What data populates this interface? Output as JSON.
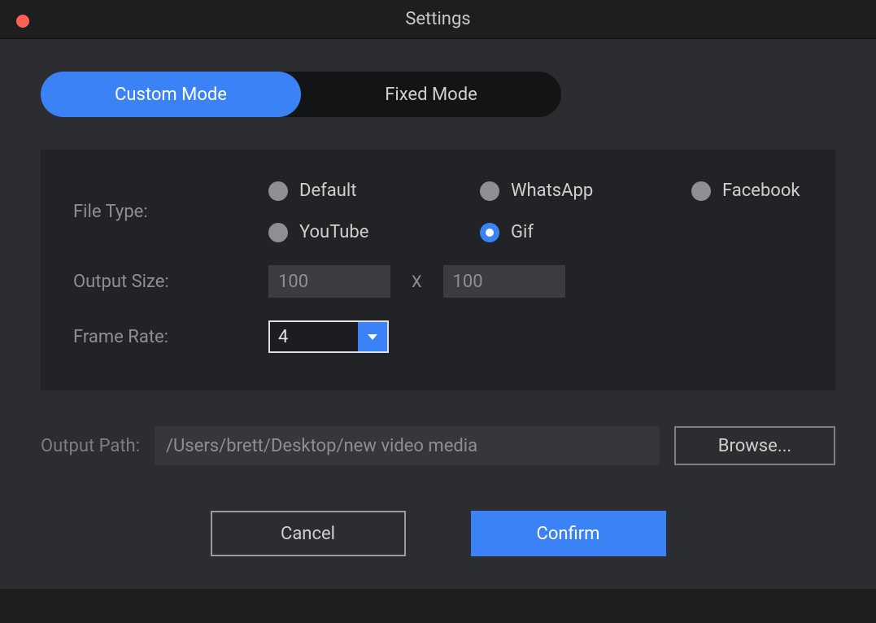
{
  "window": {
    "title": "Settings"
  },
  "tabs": {
    "custom": "Custom Mode",
    "fixed": "Fixed Mode",
    "active": "custom"
  },
  "file_type": {
    "label": "File Type:",
    "options": {
      "default": "Default",
      "whatsapp": "WhatsApp",
      "facebook": "Facebook",
      "youtube": "YouTube",
      "gif": "Gif"
    },
    "selected": "gif"
  },
  "output_size": {
    "label": "Output Size:",
    "width": "100",
    "height": "100",
    "separator": "X"
  },
  "frame_rate": {
    "label": "Frame Rate:",
    "value": "4"
  },
  "output_path": {
    "label": "Output Path:",
    "value": "/Users/brett/Desktop/new video media"
  },
  "buttons": {
    "browse": "Browse...",
    "cancel": "Cancel",
    "confirm": "Confirm"
  }
}
